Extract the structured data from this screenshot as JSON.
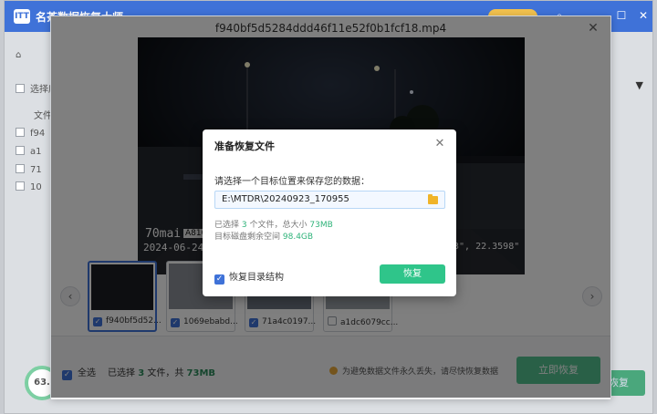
{
  "app": {
    "logo_text": "ITT",
    "name": "名茶数据恢复大师",
    "minimize": "–",
    "restore": "☐",
    "close": "✕",
    "search_icon": "search-icon",
    "left_rows": [
      "选择库",
      "文件",
      "f94",
      "a1",
      "71",
      "10"
    ],
    "progress": "63.",
    "progress_unit": "%",
    "bg_button": "恢复"
  },
  "preview": {
    "title": "f940bf5d5284ddd46f11e52f0b1fcf18.mp4",
    "close_label": "✕",
    "video": {
      "osd_brand": "70mai",
      "osd_model": "A810",
      "osd_date": "2024-06-24",
      "osd_coords": "3\", 22.3598\""
    },
    "thumbnails": [
      {
        "name": "f940bf5d52...",
        "checked": true
      },
      {
        "name": "1069ebabd...",
        "checked": true
      },
      {
        "name": "71a4c0197...",
        "checked": true
      },
      {
        "name": "a1dc6079cc...",
        "checked": false
      }
    ],
    "prev_arrow": "‹",
    "next_arrow": "›",
    "footer": {
      "select_all": "全选",
      "selected_prefix": "已选择",
      "selected_count": "3",
      "selected_mid": "文件，共",
      "selected_size": "73MB",
      "warning": "为避免数据文件永久丢失，请尽快恢复数据",
      "recover_now": "立即恢复"
    }
  },
  "dialog": {
    "title": "准备恢复文件",
    "close_label": "✕",
    "prompt": "请选择一个目标位置来保存您的数据：",
    "path": "E:\\MTDR\\20240923_170955",
    "info1_prefix": "已选择",
    "info1_count": "3",
    "info1_mid": "个文件，总大小",
    "info1_size": "73MB",
    "info2_prefix": "目标磁盘剩余空间",
    "info2_size": "98.4GB",
    "keep_structure": "恢复目录结构",
    "recover_btn": "恢复"
  },
  "colors": {
    "accent": "#3f72d8",
    "green": "#2fc58a",
    "warning": "#e9a93a"
  }
}
